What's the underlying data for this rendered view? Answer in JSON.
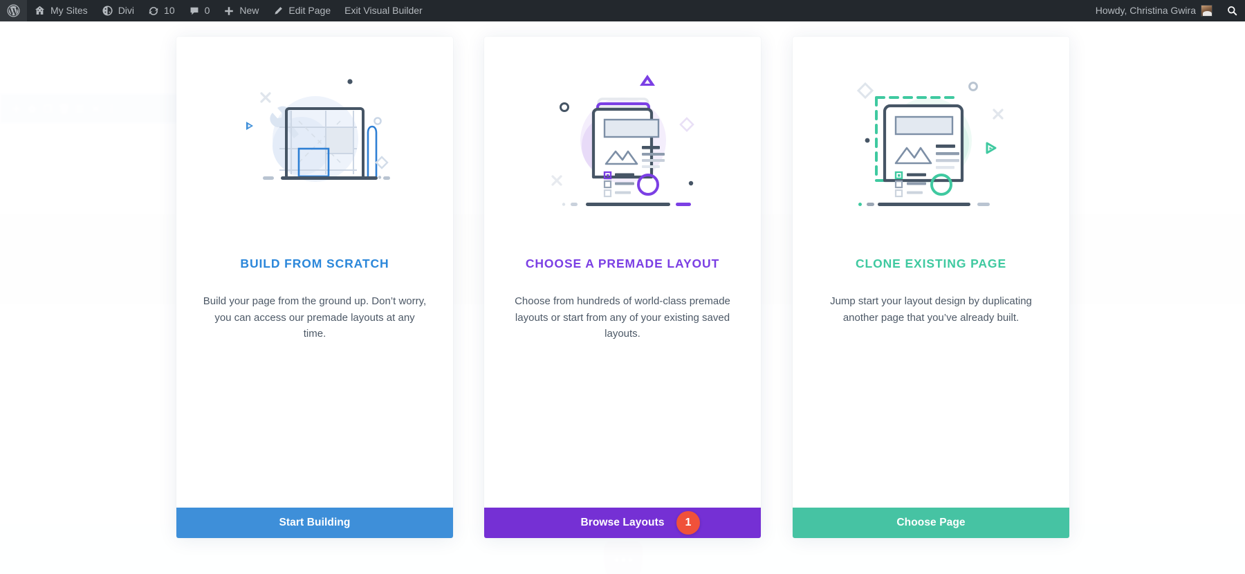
{
  "adminbar": {
    "items": [
      {
        "icon": "wordpress-logo-icon",
        "label": ""
      },
      {
        "icon": "my-sites-icon",
        "label": "My Sites"
      },
      {
        "icon": "divi-icon",
        "label": "Divi"
      },
      {
        "icon": "updates-icon",
        "label": "10"
      },
      {
        "icon": "comments-icon",
        "label": "0"
      },
      {
        "icon": "plus-icon",
        "label": "New"
      },
      {
        "icon": "pencil-icon",
        "label": "Edit Page"
      },
      {
        "icon": "exit-icon",
        "label": "Exit Visual Builder"
      }
    ],
    "howdy": "Howdy, Christina Gwira",
    "avatar_name": "avatar",
    "search_icon": "search-icon"
  },
  "colors": {
    "accent_blue": "#3e8fd9",
    "accent_purple": "#7530d4",
    "accent_green": "#46c3a3",
    "title_blue": "#2b87da",
    "title_purple": "#7b3fe4",
    "title_green": "#3fc9a0",
    "badge_red": "#f0513a",
    "adminbar_bg": "#23282d"
  },
  "cards": [
    {
      "id": "build-from-scratch",
      "illustration": "blueprint-wrench-pencil-illustration",
      "title": "BUILD FROM SCRATCH",
      "description": "Build your page from the ground up. Don’t worry, you can access our premade layouts at any time.",
      "button_label": "Start Building",
      "badge": null
    },
    {
      "id": "choose-premade-layout",
      "illustration": "premade-layout-page-illustration",
      "title": "CHOOSE A PREMADE LAYOUT",
      "description": "Choose from hundreds of world-class premade layouts or start from any of your existing saved layouts.",
      "button_label": "Browse Layouts",
      "badge": "1"
    },
    {
      "id": "clone-existing-page",
      "illustration": "clone-page-dashed-selection-illustration",
      "title": "CLONE EXISTING PAGE",
      "description": "Jump start your layout design by duplicating another page that you’ve already built.",
      "button_label": "Choose Page",
      "badge": null
    }
  ]
}
